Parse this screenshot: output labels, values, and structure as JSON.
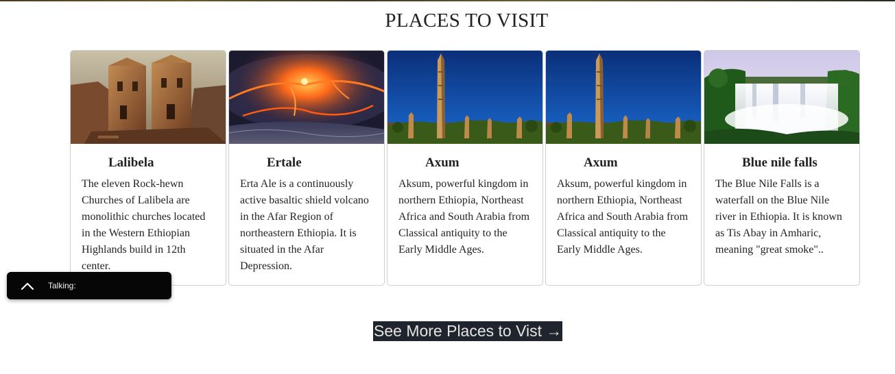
{
  "section": {
    "title": "PLACES TO VISIT"
  },
  "cards": [
    {
      "title": "Lalibela",
      "text": "The eleven Rock-hewn Churches of Lalibela are monolithic churches located in the Western Ethiopian Highlands build in 12th center.",
      "image": "rock-hewn-church-photo"
    },
    {
      "title": "Ertale",
      "text": "Erta Ale is a continuously active basaltic shield volcano in the Afar Region of northeastern Ethiopia. It is situated in the Afar Depression.",
      "image": "lava-lake-photo"
    },
    {
      "title": "Axum",
      "text": "Aksum, powerful kingdom in northern Ethiopia, Northeast Africa and South Arabia from Classical antiquity to the Early Middle Ages.",
      "image": "obelisk-photo"
    },
    {
      "title": "Axum",
      "text": "Aksum, powerful kingdom in northern Ethiopia, Northeast Africa and South Arabia from Classical antiquity to the Early Middle Ages.",
      "image": "obelisk-photo"
    },
    {
      "title": "Blue nile falls",
      "text": "The Blue Nile Falls is a waterfall on the Blue Nile river in Ethiopia. It is known as Tis Abay in Amharic, meaning \"great smoke\"..",
      "image": "waterfall-photo"
    }
  ],
  "talk_widget": {
    "label": "Talking:",
    "icon": "chevron-up-icon"
  },
  "see_more": {
    "label": "See More Places to Vist →"
  },
  "colors": {
    "button_bg": "#20242c",
    "button_text": "#e4e4e4",
    "widget_bg": "#060606"
  }
}
